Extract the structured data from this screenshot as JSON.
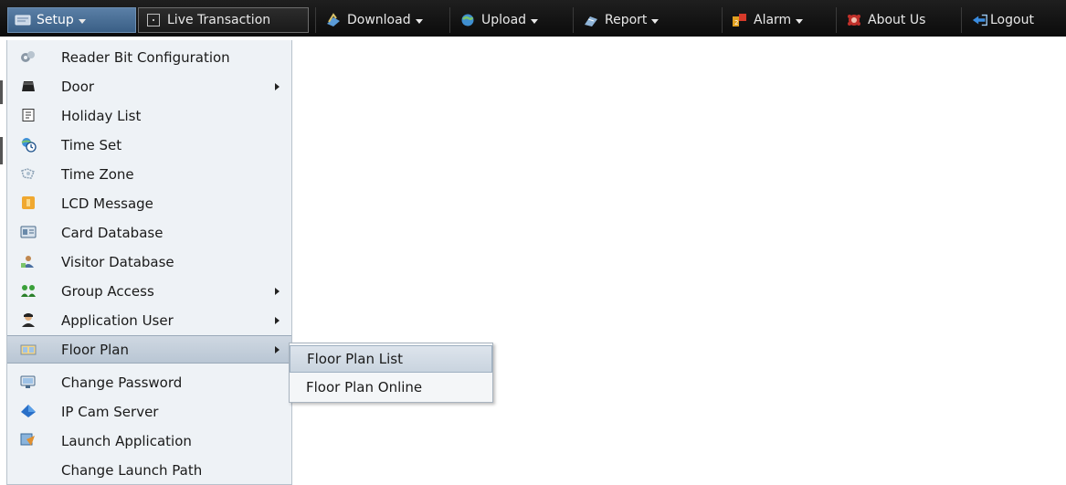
{
  "menubar": {
    "items": [
      {
        "label": "Setup",
        "icon": "setup-icon",
        "has_caret": true,
        "active": true
      },
      {
        "label": "Live Transaction",
        "icon": "live-transaction-icon",
        "has_caret": false
      },
      {
        "label": "Download",
        "icon": "download-icon",
        "has_caret": true
      },
      {
        "label": "Upload",
        "icon": "upload-icon",
        "has_caret": true
      },
      {
        "label": "Report",
        "icon": "report-icon",
        "has_caret": true
      },
      {
        "label": "Alarm",
        "icon": "alarm-icon",
        "has_caret": true
      },
      {
        "label": "About Us",
        "icon": "about-us-icon",
        "has_caret": false
      },
      {
        "label": "Logout",
        "icon": "logout-icon",
        "has_caret": false
      }
    ]
  },
  "setup_menu": {
    "items": [
      {
        "label": "Reader Bit Configuration",
        "icon": "reader-bit-icon",
        "submenu": false
      },
      {
        "label": "Door",
        "icon": "door-icon",
        "submenu": true
      },
      {
        "label": "Holiday List",
        "icon": "holiday-list-icon",
        "submenu": false
      },
      {
        "label": "Time Set",
        "icon": "time-set-icon",
        "submenu": false
      },
      {
        "label": "Time Zone",
        "icon": "time-zone-icon",
        "submenu": false
      },
      {
        "label": "LCD Message",
        "icon": "lcd-message-icon",
        "submenu": false
      },
      {
        "label": "Card Database",
        "icon": "card-database-icon",
        "submenu": false
      },
      {
        "label": "Visitor Database",
        "icon": "visitor-database-icon",
        "submenu": false
      },
      {
        "label": "Group Access",
        "icon": "group-access-icon",
        "submenu": true
      },
      {
        "label": "Application User",
        "icon": "application-user-icon",
        "submenu": true
      },
      {
        "label": "Floor Plan",
        "icon": "floor-plan-icon",
        "submenu": true,
        "active": true
      },
      {
        "label": "Change Password",
        "icon": "change-password-icon",
        "submenu": false
      },
      {
        "label": "IP Cam Server",
        "icon": "ip-cam-server-icon",
        "submenu": false
      },
      {
        "label": "Launch Application",
        "icon": "launch-application-icon",
        "submenu": false
      },
      {
        "label": "Change Launch Path",
        "icon": "",
        "submenu": false
      }
    ]
  },
  "floor_plan_submenu": {
    "items": [
      {
        "label": "Floor Plan List",
        "active": true
      },
      {
        "label": "Floor Plan Online"
      }
    ]
  },
  "colors": {
    "menubar_bg": "#121212",
    "menu_active": "#3a5f86",
    "dropdown_bg": "#eef2f6",
    "highlight": "#c9d4df"
  }
}
